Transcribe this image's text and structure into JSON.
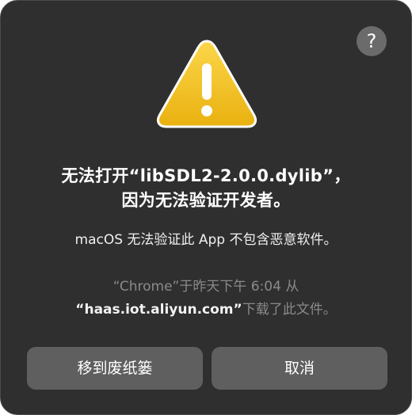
{
  "dialog": {
    "help_symbol": "?",
    "icon": "warning-triangle-icon",
    "title_line1": "无法打开“libSDL2-2.0.0.dylib”，",
    "title_line2": "因为无法验证开发者。",
    "message": "macOS 无法验证此 App 不包含恶意软件。",
    "source_prefix": "“Chrome”于昨天下午 6:04 从",
    "source_host": "“haas.iot.aliyun.com”",
    "source_suffix": "下载了此文件。",
    "buttons": {
      "move_to_trash": "移到废纸篓",
      "cancel": "取消"
    },
    "colors": {
      "background": "#2f2f2f",
      "button": "#5f5f5f",
      "warning_yellow": "#f5c518"
    }
  }
}
